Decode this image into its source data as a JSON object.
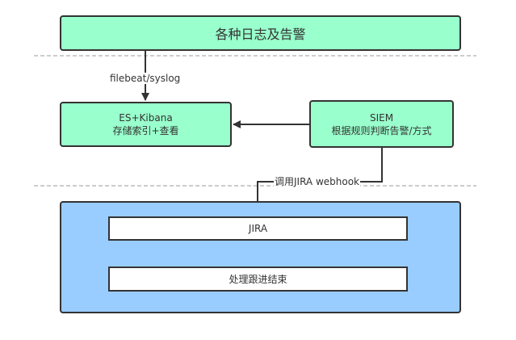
{
  "nodes": {
    "sources": "各种日志及告警",
    "es_title": "ES+Kibana",
    "es_desc": "存储索引+查看",
    "siem_title": "SIEM",
    "siem_desc": "根据规则判断告警/方式",
    "jira": "JIRA",
    "process": "处理跟进结束"
  },
  "edges": {
    "filebeat": "filebeat/syslog",
    "webhook": "调用JIRA webhook"
  },
  "colors": {
    "green": "#99ffcc",
    "blue": "#99ccff",
    "stroke": "#333333"
  }
}
